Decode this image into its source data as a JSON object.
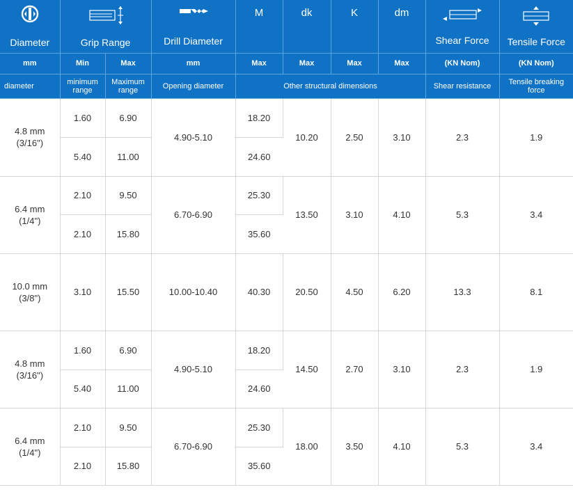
{
  "header": {
    "diameter": {
      "title": "Diameter",
      "unit": "mm",
      "sub": "diameter"
    },
    "grip": {
      "title": "Grip Range",
      "min_label": "Min",
      "max_label": "Max",
      "min_sub": "minimum range",
      "max_sub": "Maximum range"
    },
    "drill": {
      "title": "Drill Diameter",
      "unit": "mm",
      "sub": "Opening diameter"
    },
    "m": {
      "title": "M",
      "unit": "Max"
    },
    "dk": {
      "title": "dk",
      "unit": "Max"
    },
    "k": {
      "title": "K",
      "unit": "Max"
    },
    "dm": {
      "title": "dm",
      "unit": "Max"
    },
    "other_sub": "Other structural dimensions",
    "shear": {
      "title": "Shear Force",
      "unit": "(KN Nom)",
      "sub": "Shear resistance"
    },
    "tensile": {
      "title": "Tensile Force",
      "unit": "(KN Nom)",
      "sub": "Tensile breaking force"
    }
  },
  "groups": [
    {
      "diameter": "4.8 mm",
      "diameter_in": "(3/16\")",
      "rows": [
        {
          "min": "1.60",
          "max": "6.90",
          "m": "18.20"
        },
        {
          "min": "5.40",
          "max": "11.00",
          "m": "24.60"
        }
      ],
      "drill": "4.90-5.10",
      "dk": "10.20",
      "k": "2.50",
      "dm": "3.10",
      "shear": "2.3",
      "tensile": "1.9"
    },
    {
      "diameter": "6.4 mm",
      "diameter_in": "(1/4\")",
      "rows": [
        {
          "min": "2.10",
          "max": "9.50",
          "m": "25.30"
        },
        {
          "min": "2.10",
          "max": "15.80",
          "m": "35.60"
        }
      ],
      "drill": "6.70-6.90",
      "dk": "13.50",
      "k": "3.10",
      "dm": "4.10",
      "shear": "5.3",
      "tensile": "3.4"
    },
    {
      "diameter": "10.0 mm",
      "diameter_in": "(3/8\")",
      "rows": [
        {
          "min": "3.10",
          "max": "15.50",
          "m": "40.30"
        }
      ],
      "drill": "10.00-10.40",
      "dk": "20.50",
      "k": "4.50",
      "dm": "6.20",
      "shear": "13.3",
      "tensile": "8.1"
    },
    {
      "diameter": "4.8 mm",
      "diameter_in": "(3/16\")",
      "rows": [
        {
          "min": "1.60",
          "max": "6.90",
          "m": "18.20"
        },
        {
          "min": "5.40",
          "max": "11.00",
          "m": "24.60"
        }
      ],
      "drill": "4.90-5.10",
      "dk": "14.50",
      "k": "2.70",
      "dm": "3.10",
      "shear": "2.3",
      "tensile": "1.9"
    },
    {
      "diameter": "6.4 mm",
      "diameter_in": "(1/4\")",
      "rows": [
        {
          "min": "2.10",
          "max": "9.50",
          "m": "25.30"
        },
        {
          "min": "2.10",
          "max": "15.80",
          "m": "35.60"
        }
      ],
      "drill": "6.70-6.90",
      "dk": "18.00",
      "k": "3.50",
      "dm": "4.10",
      "shear": "5.3",
      "tensile": "3.4"
    }
  ],
  "icons": {
    "diameter": "rivet-diameter-icon",
    "grip": "grip-range-icon",
    "drill": "drill-bit-icon",
    "shear": "shear-force-icon",
    "tensile": "tensile-force-icon"
  },
  "colors": {
    "header_bg": "#0f72c5",
    "header_text": "#ffffff",
    "unit_text": "#a9cdee",
    "grid": "#d6d6d6"
  }
}
